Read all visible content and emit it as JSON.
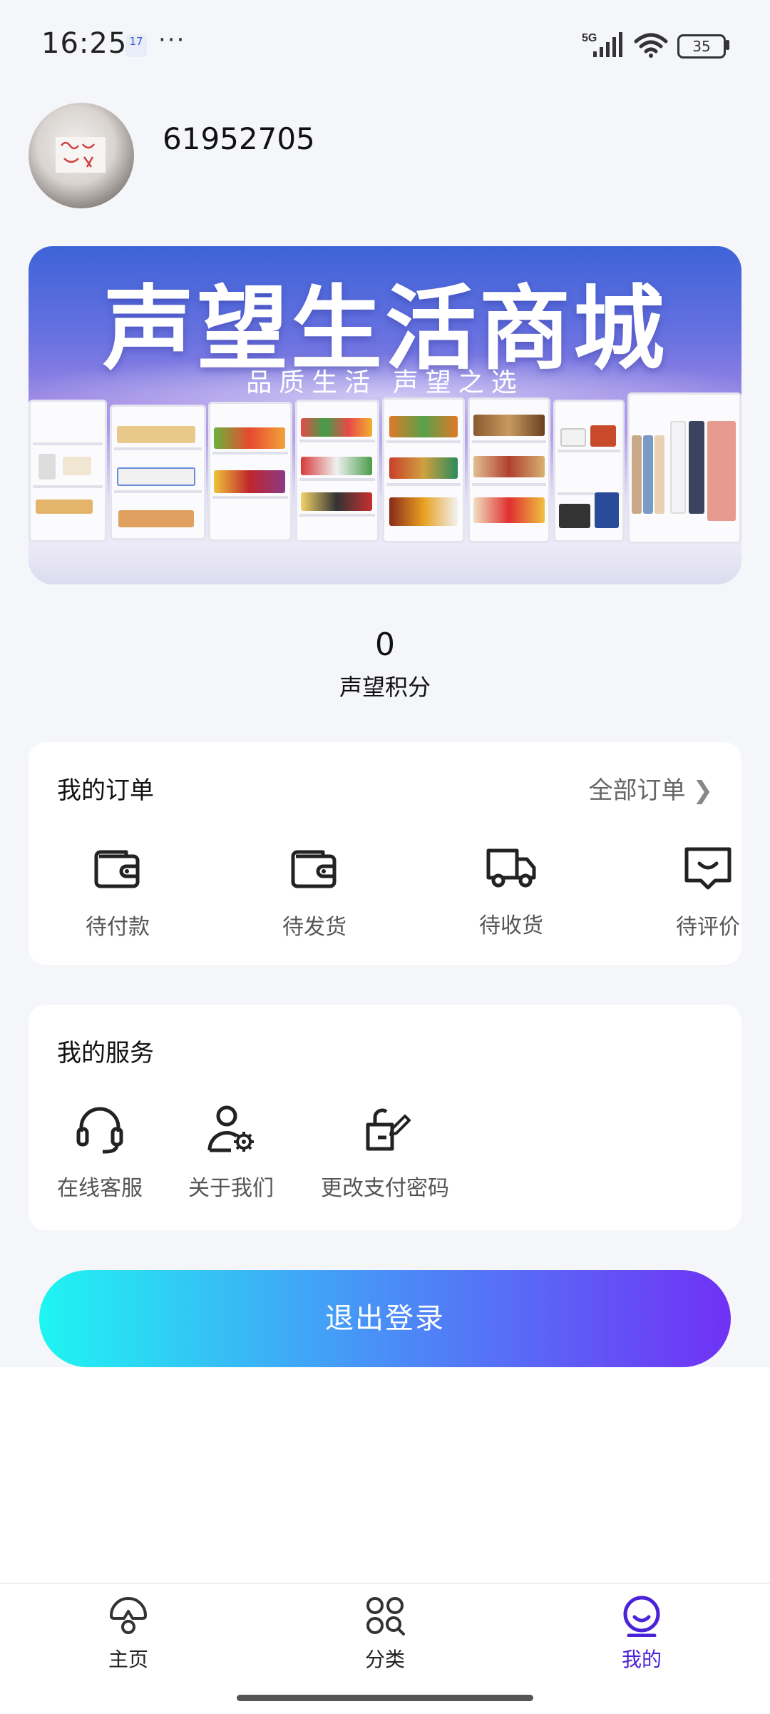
{
  "status_bar": {
    "time": "16:25",
    "calendar_badge": "17",
    "more": "···",
    "network": "5G",
    "battery": "35"
  },
  "profile": {
    "username": "61952705"
  },
  "banner": {
    "title": "声望生活商城",
    "subtitle": "品质生活 声望之选"
  },
  "points": {
    "value": "0",
    "label": "声望积分"
  },
  "orders": {
    "title": "我的订单",
    "all_label": "全部订单",
    "items": [
      {
        "label": "待付款",
        "icon": "wallet-icon"
      },
      {
        "label": "待发货",
        "icon": "wallet-icon"
      },
      {
        "label": "待收货",
        "icon": "truck-icon"
      },
      {
        "label": "待评价",
        "icon": "comment-icon"
      }
    ]
  },
  "services": {
    "title": "我的服务",
    "items": [
      {
        "label": "在线客服",
        "icon": "headset-icon"
      },
      {
        "label": "关于我们",
        "icon": "user-gear-icon"
      },
      {
        "label": "更改支付密码",
        "icon": "edit-lock-icon"
      }
    ]
  },
  "logout_label": "退出登录",
  "nav": {
    "items": [
      {
        "label": "主页",
        "icon": "home-icon"
      },
      {
        "label": "分类",
        "icon": "category-icon"
      },
      {
        "label": "我的",
        "icon": "profile-icon"
      }
    ],
    "active_color": "#4a22d8"
  },
  "colors": {
    "logout_gradient_start": "#1ff5f2",
    "logout_gradient_end": "#7031f5"
  }
}
